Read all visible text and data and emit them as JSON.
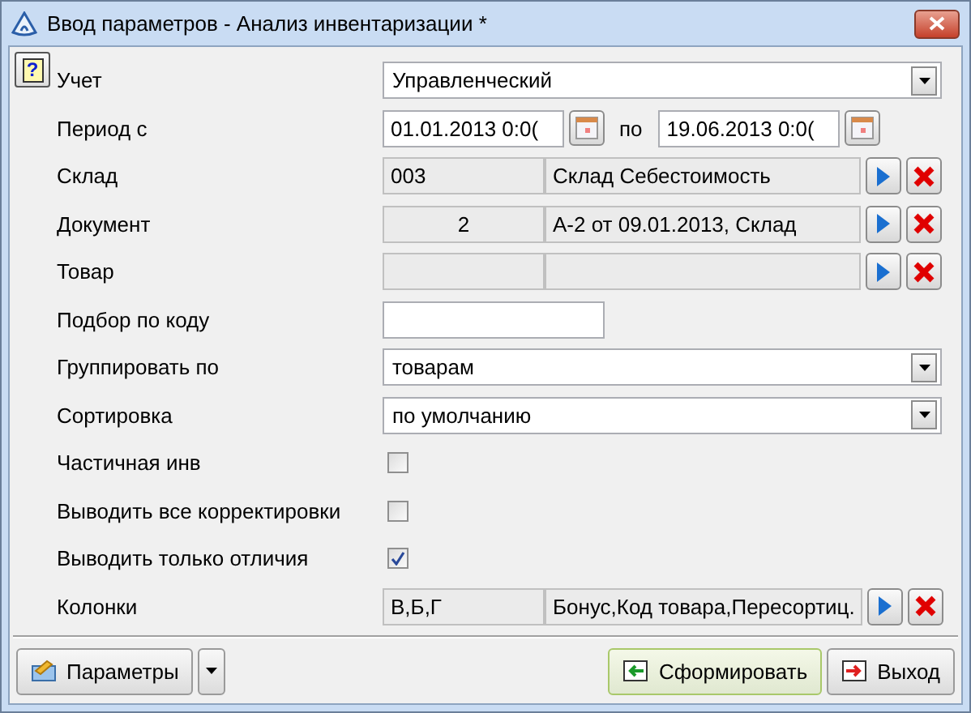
{
  "window": {
    "title": "Ввод параметров - Анализ инвентаризации *"
  },
  "help_button": {
    "label": "?"
  },
  "rows": [
    {
      "kind": "combo",
      "label": "Учет",
      "value": "Управленческий"
    },
    {
      "kind": "daterange",
      "label": "Период с",
      "from": "01.01.2013 0:0(",
      "separator": "по",
      "to": "19.06.2013 0:0("
    },
    {
      "kind": "lookup",
      "label": "Склад",
      "code": "003",
      "code_centered": false,
      "name": "Склад Себестоимость"
    },
    {
      "kind": "lookup",
      "label": "Документ",
      "code": "2",
      "code_centered": true,
      "name": "А-2 от 09.01.2013, Склад"
    },
    {
      "kind": "lookup",
      "label": "Товар"
    },
    {
      "kind": "text",
      "label": "Подбор по коду"
    },
    {
      "kind": "combo",
      "label": "Группировать по",
      "value": "товарам"
    },
    {
      "kind": "combo",
      "label": "Сортировка",
      "value": "по умолчанию"
    },
    {
      "kind": "checkbox",
      "label": "Частичная инв",
      "checked": false
    },
    {
      "kind": "checkbox",
      "label": "Выводить все корректировки",
      "checked": false
    },
    {
      "kind": "checkbox",
      "label": "Выводить только отличия",
      "checked": true
    },
    {
      "kind": "lookup",
      "label": "Колонки",
      "code": "В,Б,Г",
      "code_centered": false,
      "name": "Бонус,Код товара,Пересортиц."
    }
  ],
  "footer": {
    "params_button": "Параметры",
    "run_button": "Сформировать",
    "exit_button": "Выход"
  }
}
